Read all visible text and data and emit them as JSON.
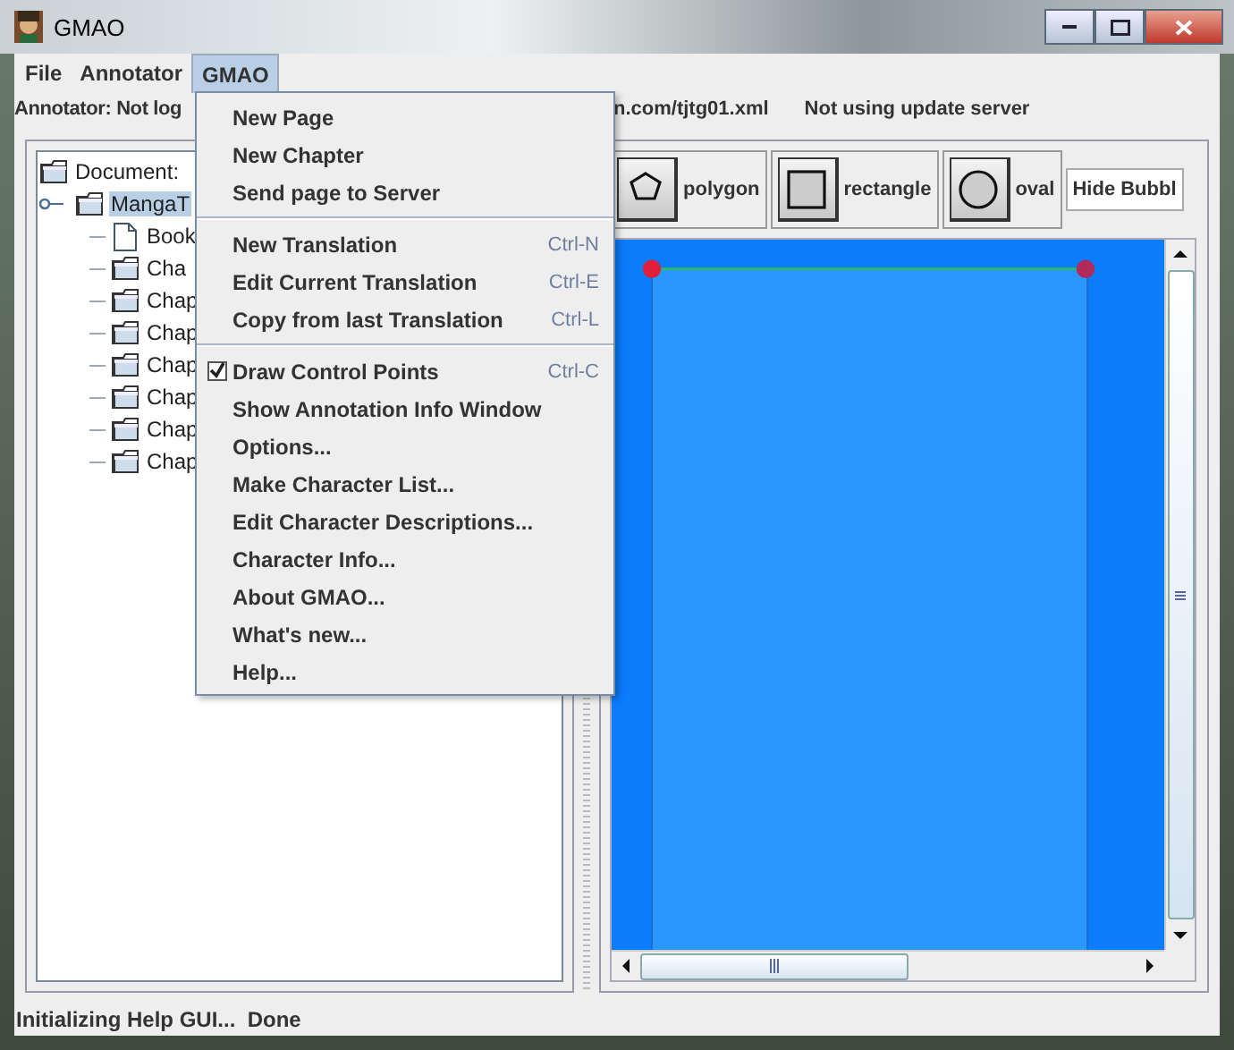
{
  "window": {
    "title": "GMAO"
  },
  "menubar": [
    {
      "label": "File",
      "selected": false
    },
    {
      "label": "Annotator",
      "selected": false
    },
    {
      "label": "GMAO",
      "selected": true
    }
  ],
  "info_bar": [
    {
      "text": "Annotator: Not log"
    },
    {
      "text": "n.com/tjtg01.xml"
    },
    {
      "text": "Not using update server"
    }
  ],
  "tree": {
    "label": "Document:",
    "selected": false,
    "children": [
      {
        "label": "MangaT",
        "selected": true,
        "children": [
          {
            "label": "Book",
            "kind": "file",
            "selected": false
          },
          {
            "label": "Cha",
            "kind": "folder",
            "selected": false
          },
          {
            "label": "Chap",
            "kind": "folder",
            "selected": false
          },
          {
            "label": "Chap",
            "kind": "folder",
            "selected": false
          },
          {
            "label": "Chap",
            "kind": "folder",
            "selected": false
          },
          {
            "label": "Chap",
            "kind": "folder",
            "selected": false
          },
          {
            "label": "Chap",
            "kind": "folder",
            "selected": false
          },
          {
            "label": "Chap",
            "kind": "folder",
            "selected": false
          }
        ]
      }
    ]
  },
  "tools": [
    {
      "label": "polygon",
      "kind": "polygon"
    },
    {
      "label": "rectangle",
      "kind": "rectangle"
    },
    {
      "label": "oval",
      "kind": "oval"
    },
    {
      "label": "Hide Bubbl",
      "kind": "text"
    }
  ],
  "menu": [
    [
      {
        "label": "New Page",
        "kind": "item"
      },
      {
        "label": "New Chapter",
        "kind": "item"
      },
      {
        "label": "Send page to Server",
        "kind": "item"
      }
    ],
    [
      {
        "label": "New Translation",
        "kind": "item",
        "shortcut": "Ctrl-N"
      },
      {
        "label": "Edit Current Translation",
        "kind": "item",
        "shortcut": "Ctrl-E"
      },
      {
        "label": "Copy from last Translation",
        "kind": "item",
        "shortcut": "Ctrl-L"
      }
    ],
    [
      {
        "label": "Draw Control Points",
        "kind": "check",
        "checked": true,
        "shortcut": "Ctrl-C"
      },
      {
        "label": "Show Annotation Info Window",
        "kind": "item"
      },
      {
        "label": "Options...",
        "kind": "item"
      },
      {
        "label": "Make Character List...",
        "kind": "item"
      },
      {
        "label": "Edit Character Descriptions...",
        "kind": "item"
      },
      {
        "label": "Character Info...",
        "kind": "item"
      },
      {
        "label": "About GMAO...",
        "kind": "item"
      },
      {
        "label": "What's new...",
        "kind": "item"
      },
      {
        "label": "Help...",
        "kind": "item"
      }
    ]
  ],
  "status_bar": "Initializing Help GUI...  Done"
}
